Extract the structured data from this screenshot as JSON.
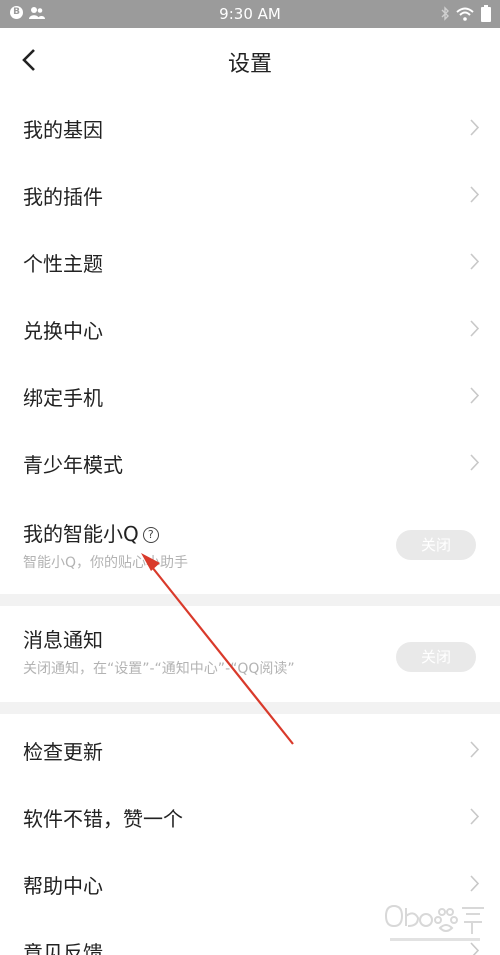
{
  "status_bar": {
    "time": "9:30 AM"
  },
  "header": {
    "title": "设置"
  },
  "menu": {
    "genes": "我的基因",
    "plugins": "我的插件",
    "themes": "个性主题",
    "exchange": "兑换中心",
    "bind_phone": "绑定手机",
    "teen_mode": "青少年模式"
  },
  "smart_q": {
    "label": "我的智能小Q",
    "subtitle": "智能小Q，你的贴心小助手",
    "toggle_label": "关闭"
  },
  "notification": {
    "label": "消息通知",
    "subtitle": "关闭通知，在“设置”-“通知中心”-“QQ阅读”",
    "toggle_label": "关闭"
  },
  "menu2": {
    "check_update": "检查更新",
    "like_app": "软件不错，赞一个",
    "help_center": "帮助中心",
    "feedback": "意见反馈"
  },
  "colors": {
    "status_bar": "#9b9b9b",
    "divider": "#f2f2f2",
    "toggle_off": "#e9e9e9",
    "annotation_arrow": "#d93a2b"
  }
}
